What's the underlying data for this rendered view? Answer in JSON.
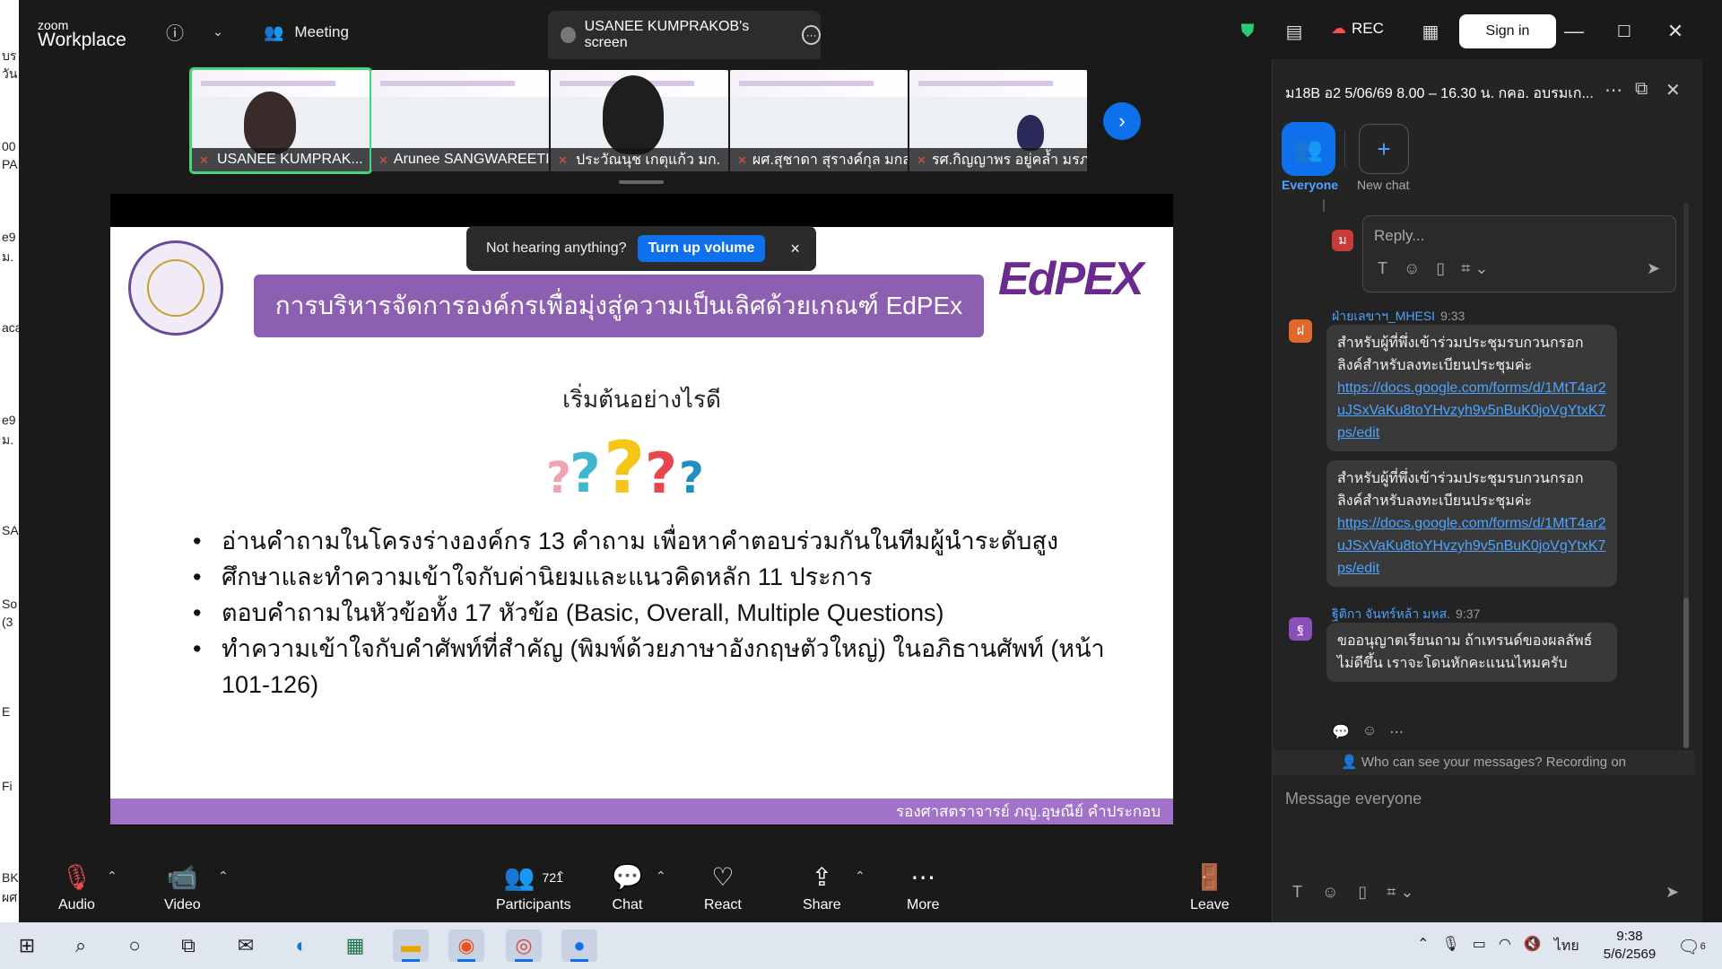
{
  "left_strip": [
    "บร",
    "วัน",
    "00",
    "PA",
    "e9",
    "ม.",
    "aca",
    "e9",
    "ม.",
    "SA",
    "So",
    "(3",
    "E",
    "Fi",
    "BK",
    "ผศ"
  ],
  "topbar": {
    "logo_small": "zoom",
    "logo_big": "Workplace",
    "meeting_label": "Meeting",
    "screen_tab_label": "USANEE KUMPRAKOB's screen",
    "rec_label": "REC",
    "signin_label": "Sign in"
  },
  "thumbnails": [
    {
      "name": "USANEE KUMPRAK...",
      "active": true
    },
    {
      "name": "Arunee SANGWAREETI...",
      "active": false
    },
    {
      "name": "ประวัณนุช เกตุแก้ว มก.",
      "active": false
    },
    {
      "name": "ผศ.สุชาดา สุรางค์กุล มกส.",
      "active": false
    },
    {
      "name": "รศ.กิญญาพร อยู่คล้ำ มรภ...",
      "active": false
    }
  ],
  "banner": {
    "text": "Not hearing anything?",
    "button": "Turn up volume",
    "close": "×"
  },
  "slide": {
    "title": "การบริหารจัดการองค์กรเพื่อมุ่งสู่ความเป็นเลิศด้วยเกณฑ์ EdPEx",
    "logo_text": "EdPEX",
    "subtitle": "เริ่มต้นอย่างไรดี",
    "bullets": [
      "อ่านคำถามในโครงร่างองค์กร 13 คำถาม เพื่อหาคำตอบร่วมกันในทีมผู้นำระดับสูง",
      "ศึกษาและทำความเข้าใจกับค่านิยมและแนวคิดหลัก 11 ประการ",
      "ตอบคำถามในหัวข้อทั้ง 17 หัวข้อ (Basic, Overall, Multiple Questions)",
      "ทำความเข้าใจกับคำศัพท์ที่สำคัญ (พิมพ์ด้วยภาษาอังกฤษตัวใหญ่) ในอภิธานศัพท์ (หน้า 101-126)"
    ],
    "footer": "รองศาสตราจารย์ ภญ.อุษณีย์ คำประกอบ"
  },
  "controls": {
    "audio": "Audio",
    "video": "Video",
    "participants": "Participants",
    "participants_count": "721",
    "chat": "Chat",
    "react": "React",
    "share": "Share",
    "more": "More",
    "leave": "Leave"
  },
  "chat": {
    "title": "ม18B อ2 5/06/69 8.00 – 16.30 น. กคอ. อบรมเก...",
    "tab_everyone": "Everyone",
    "tab_new": "New chat",
    "reply_placeholder": "Reply...",
    "reply_avatar": "ม",
    "messages": [
      {
        "avatar": "ฝ",
        "avatar_color": "#e0682b",
        "sender": "ฝ่ายเลขาฯ_MHESI",
        "time": "9:33",
        "bubbles": [
          {
            "text": "สำหรับผู้ที่พึ่งเข้าร่วมประชุมรบกวนกรอกลิงค์สำหรับลงทะเบียนประชุมค่ะ",
            "link": "https://docs.google.com/forms/d/1MtT4ar2uJSxVaKu8toYHvzyh9v5nBuK0joVgYtxK7ps/edit"
          },
          {
            "text": "สำหรับผู้ที่พึ่งเข้าร่วมประชุมรบกวนกรอกลิงค์สำหรับลงทะเบียนประชุมค่ะ",
            "link": "https://docs.google.com/forms/d/1MtT4ar2uJSxVaKu8toYHvzyh9v5nBuK0joVgYtxK7ps/edit"
          }
        ]
      },
      {
        "avatar": "ฐ",
        "avatar_color": "#8a4fb8",
        "sender": "ฐิติกา จันทร์หล้า มหส.",
        "time": "9:37",
        "bubbles": [
          {
            "text": "ขออนุญาตเรียนถาม ถ้าเทรนด์ของผลลัพธ์ไม่ดีขึ้น เราจะโดนหักคะแนนไหมครับ",
            "link": ""
          }
        ]
      }
    ],
    "who_can_see": "Who can see your messages? Recording on",
    "input_placeholder": "Message everyone"
  },
  "taskbar": {
    "lang": "ไทย",
    "time": "9:38",
    "date": "5/6/2569",
    "notif_count": "6"
  },
  "colors": {
    "zoom_blue": "#0e71eb",
    "slide_purple": "#8c5fb0",
    "active_green": "#41d87b"
  }
}
